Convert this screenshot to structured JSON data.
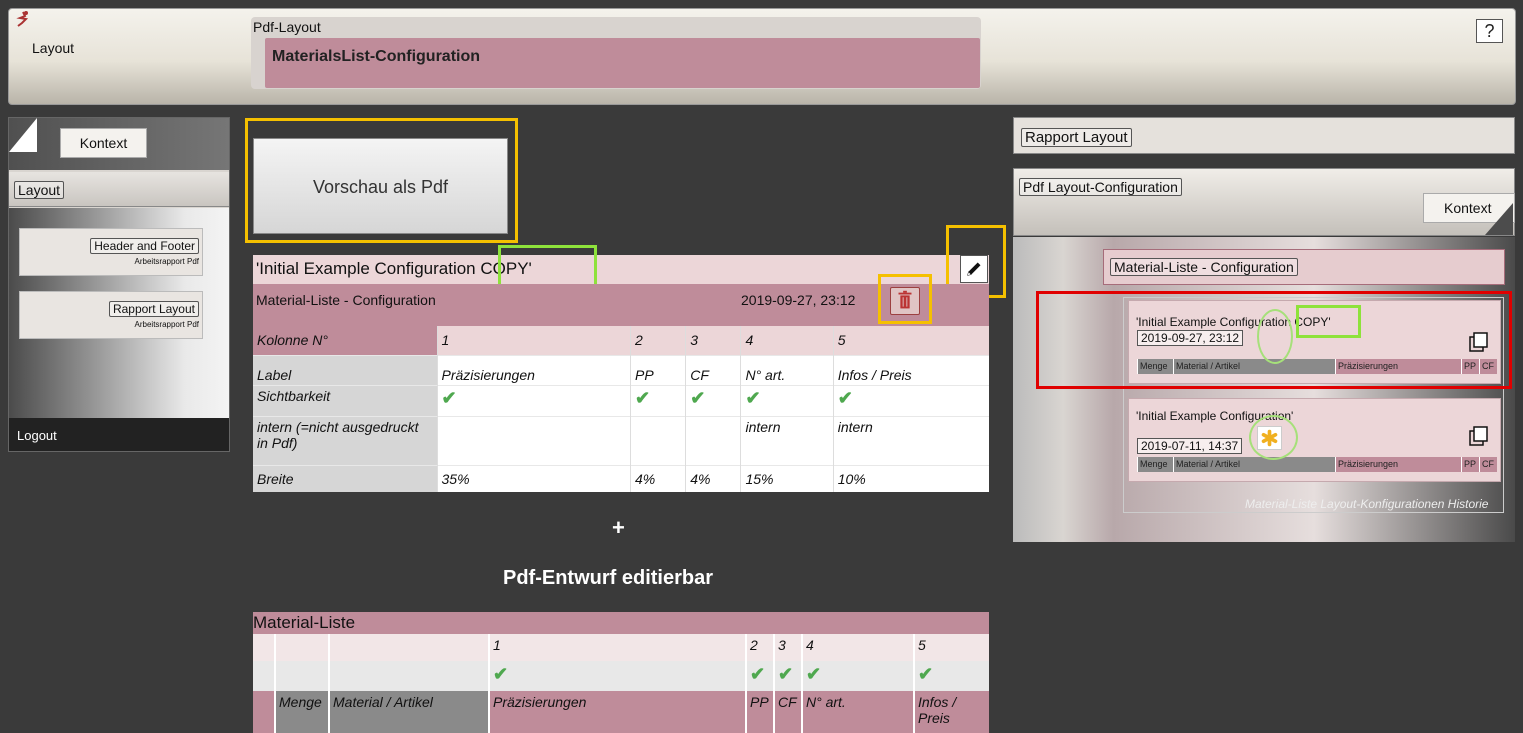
{
  "header": {
    "app_name": "Layout",
    "section_label": "Pdf-Layout",
    "page_title": "MaterialsList-Configuration",
    "help_label": "?"
  },
  "sidebar": {
    "kontext_label": "Kontext",
    "tab_label": "Layout",
    "items": [
      {
        "label": "Header and Footer",
        "sub": "Arbeitsrapport Pdf"
      },
      {
        "label": "Rapport Layout",
        "sub": "Arbeitsrapport Pdf"
      }
    ],
    "logout_label": "Logout"
  },
  "preview": {
    "label": "Vorschau als Pdf"
  },
  "config": {
    "title": "'Initial Example Configuration COPY'",
    "subtitle": "Material-Liste  -  Configuration",
    "date": "2019-09-27, 23:12",
    "row_headers": [
      "Kolonne N°",
      "Label",
      "Sichtbarkeit",
      "intern (=nicht ausgedruckt in Pdf)",
      "Breite"
    ],
    "columns": [
      {
        "num": "1",
        "label": "Präzisierungen",
        "visible": true,
        "intern": "",
        "width": "35%"
      },
      {
        "num": "2",
        "label": "PP",
        "visible": true,
        "intern": "",
        "width": "4%"
      },
      {
        "num": "3",
        "label": "CF",
        "visible": true,
        "intern": "",
        "width": "4%"
      },
      {
        "num": "4",
        "label": "N° art.",
        "visible": true,
        "intern": "intern",
        "width": "15%"
      },
      {
        "num": "5",
        "label": "Infos / Preis",
        "visible": true,
        "intern": "intern",
        "width": "10%"
      }
    ]
  },
  "plus_sign": "+",
  "draft": {
    "heading": "Pdf-Entwurf editierbar",
    "list_title": "Material-Liste",
    "nums": [
      "1",
      "2",
      "3",
      "4",
      "5"
    ],
    "headers": [
      "Menge",
      "Material / Artikel",
      "Präzisierungen",
      "PP",
      "CF",
      "N° art.",
      "Infos / Preis"
    ]
  },
  "right_panel": {
    "rapport_label": "Rapport Layout",
    "pdfcfg_label": "Pdf Layout-Configuration",
    "kontext_label": "Kontext",
    "mlcfg_label": "Material-Liste - Configuration",
    "history": [
      {
        "title": "'Initial Example Configuration COPY'",
        "date": "2019-09-27, 23:12"
      },
      {
        "title": "'Initial Example Configuration'",
        "date": "2019-07-11, 14:37"
      }
    ],
    "mini_cols": [
      "Menge",
      "Material / Artikel",
      "Präzisierungen",
      "PP",
      "CF"
    ],
    "caption": "Material-Liste Layout-Konfigurationen Historie"
  },
  "colors": {
    "accent": "#bf8c9a",
    "accent_light": "#ecd6d8",
    "highlight_yellow": "#f5c000",
    "highlight_green": "#8ee23b",
    "highlight_red": "#e00000",
    "check": "#4fa84f"
  }
}
